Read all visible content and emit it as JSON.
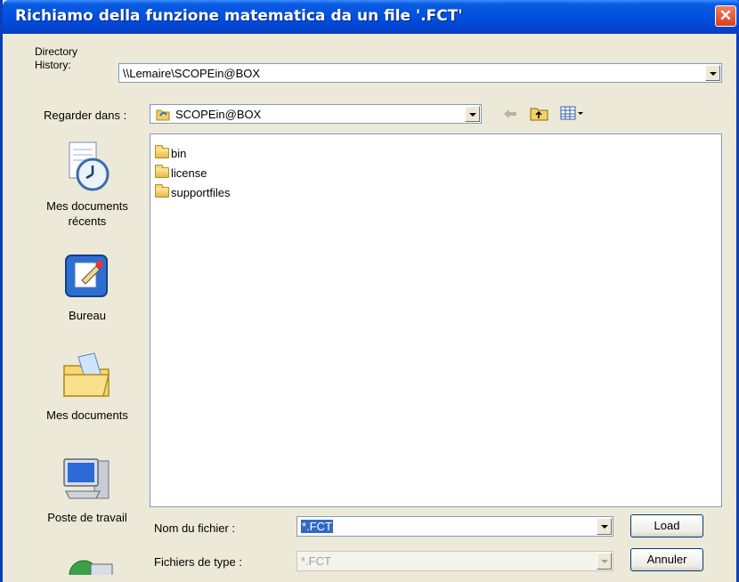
{
  "window": {
    "title": "Richiamo della funzione matematica da un file '.FCT'",
    "close_label": "✕"
  },
  "directory_history": {
    "label_line1": "Directory",
    "label_line2": "History:",
    "value": "\\\\Lemaire\\SCOPEin@BOX"
  },
  "look_in": {
    "label": "Regarder dans :",
    "value": "SCOPEin@BOX",
    "icons": [
      "back-arrow-icon",
      "up-folder-icon",
      "view-menu-icon"
    ]
  },
  "places": [
    {
      "label_line1": "Mes documents",
      "label_line2": "récents",
      "icon": "recent-documents-icon"
    },
    {
      "label_line1": "Bureau",
      "label_line2": "",
      "icon": "desktop-icon"
    },
    {
      "label_line1": "Mes documents",
      "label_line2": "",
      "icon": "my-documents-icon"
    },
    {
      "label_line1": "Poste de travail",
      "label_line2": "",
      "icon": "my-computer-icon"
    },
    {
      "label_line1": "",
      "label_line2": "",
      "icon": "network-places-icon"
    }
  ],
  "files": [
    {
      "name": "bin",
      "icon": "folder-icon"
    },
    {
      "name": "license",
      "icon": "folder-icon"
    },
    {
      "name": "supportfiles",
      "icon": "folder-icon"
    }
  ],
  "filename": {
    "label": "Nom du fichier :",
    "value": "*.FCT"
  },
  "filetype": {
    "label": "Fichiers de type :",
    "value": "*.FCT"
  },
  "buttons": {
    "load": "Load",
    "cancel": "Annuler"
  }
}
